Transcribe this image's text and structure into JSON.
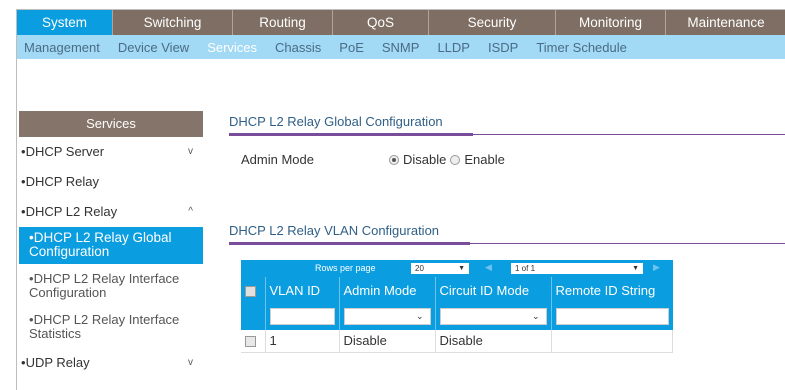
{
  "top_nav": {
    "tabs": [
      "System",
      "Switching",
      "Routing",
      "QoS",
      "Security",
      "Monitoring",
      "Maintenance"
    ],
    "active": "System"
  },
  "sub_nav": {
    "items": [
      "Management",
      "Device View",
      "Services",
      "Chassis",
      "PoE",
      "SNMP",
      "LLDP",
      "ISDP",
      "Timer Schedule"
    ],
    "active": "Services"
  },
  "sidebar": {
    "title": "Services",
    "items": [
      {
        "label": "DHCP Server",
        "chevron": "v"
      },
      {
        "label": "DHCP Relay"
      },
      {
        "label": "DHCP L2 Relay",
        "chevron": "^"
      }
    ],
    "sub_items": [
      "DHCP L2 Relay Global Configuration",
      "DHCP L2 Relay Interface Configuration",
      "DHCP L2 Relay Interface Statistics"
    ],
    "active_sub": "DHCP L2 Relay Global Configuration",
    "bottom_item": {
      "label": "UDP Relay",
      "chevron": "v"
    },
    "bullet": "•"
  },
  "global_config": {
    "title": "DHCP L2 Relay Global Configuration",
    "admin_mode_label": "Admin Mode",
    "options": [
      "Disable",
      "Enable"
    ],
    "selected": "Disable"
  },
  "vlan_config": {
    "title": "DHCP L2 Relay VLAN Configuration",
    "pager": {
      "rows_per_page_label": "Rows per page",
      "rows_per_page": "20",
      "page": "1 of 1"
    },
    "columns": [
      "VLAN ID",
      "Admin Mode",
      "Circuit ID Mode",
      "Remote ID String"
    ],
    "rows": [
      {
        "vlan_id": "1",
        "admin_mode": "Disable",
        "circuit_id_mode": "Disable",
        "remote_id_string": ""
      }
    ]
  },
  "colors": {
    "active_blue": "#0a9de0",
    "nav_brown": "#7e6e63",
    "subnav_light_blue": "#a2d9f5",
    "section_purple": "#7a4d9a"
  }
}
